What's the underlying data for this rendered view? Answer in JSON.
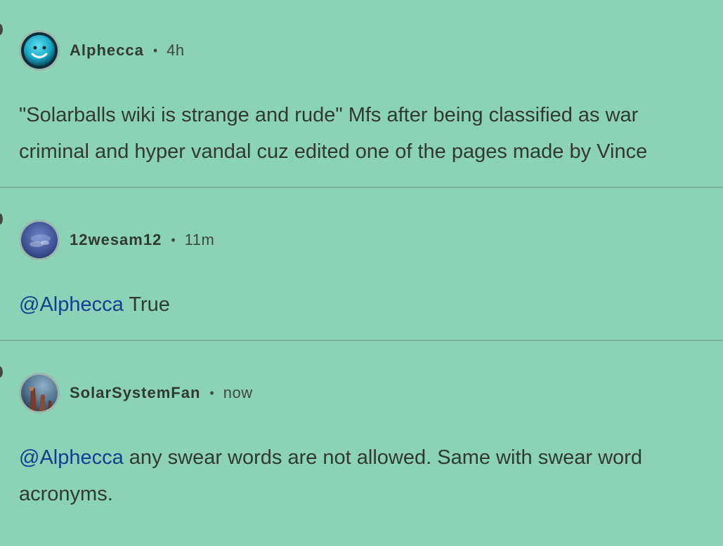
{
  "comments": [
    {
      "username": "Alphecca",
      "separator": "•",
      "time": "4h",
      "avatar_icon": "cyan-smiling-ball-avatar",
      "text_lines": [
        "\"Solarballs wiki is strange and rude\" Mfs after being classified as war",
        "criminal and hyper vandal cuz edited one of the pages made by Vince"
      ]
    },
    {
      "username": "12wesam12",
      "separator": "•",
      "time": "11m",
      "avatar_icon": "blue-planet-avatar",
      "mention": "@Alphecca",
      "text": " True"
    },
    {
      "username": "SolarSystemFan",
      "separator": "•",
      "time": "now",
      "avatar_icon": "nebula-pillars-avatar",
      "mention": "@Alphecca",
      "text_line1": " any swear words are not allowed. Same with swear word",
      "text_line2": "acronyms."
    }
  ],
  "colors": {
    "background": "#8cd2b6",
    "text": "#2f3a35",
    "mention": "#123f8f",
    "divider": "#76ac98"
  }
}
